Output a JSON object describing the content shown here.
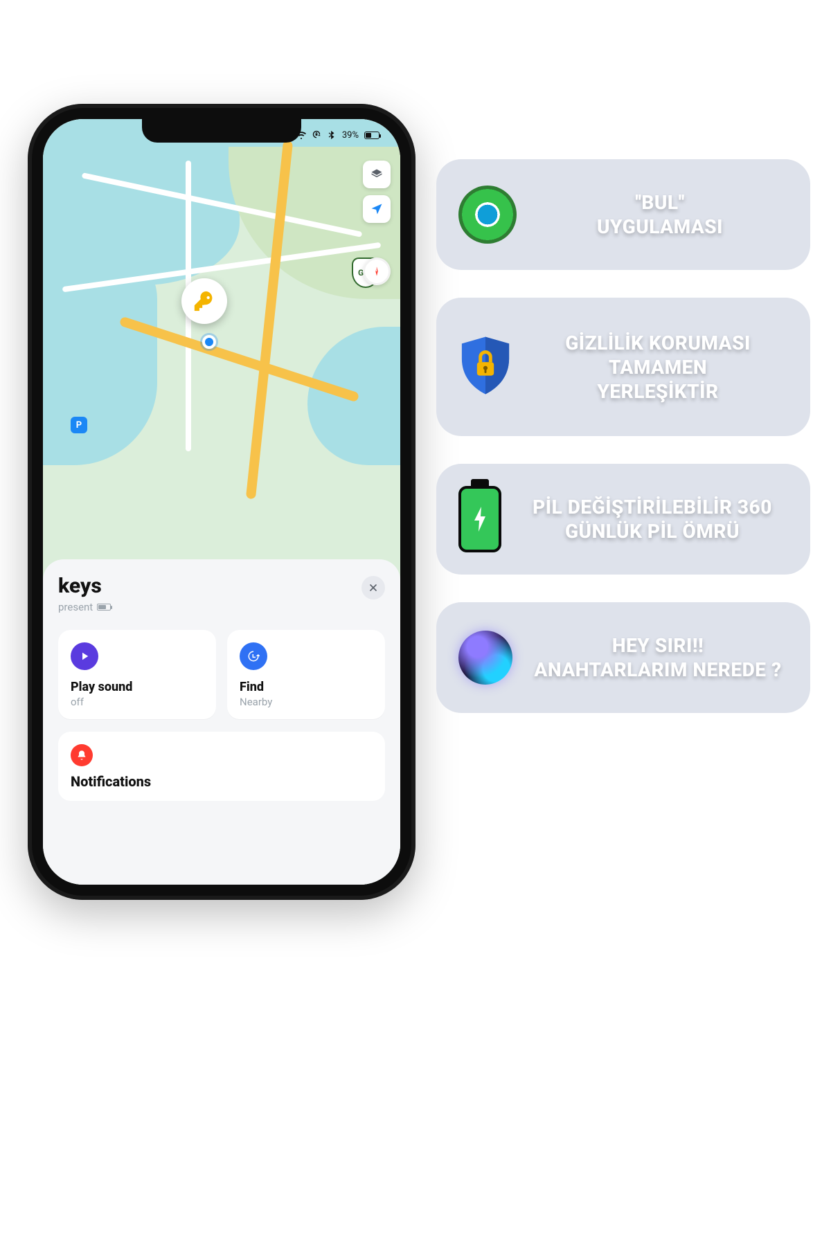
{
  "status": {
    "battery_text": "39%"
  },
  "map": {
    "highway_shield": "G15",
    "park_mark": "P"
  },
  "sheet": {
    "title": "keys",
    "subtitle": "present",
    "play": {
      "title": "Play sound",
      "sub": "off"
    },
    "find": {
      "title": "Find",
      "sub": "Nearby"
    },
    "notifications": "Notifications"
  },
  "features": {
    "find_app": "''BUL''\nUYGULAMASI",
    "privacy": "GİZLİLİK KORUMASI\nTAMAMEN\nYERLEŞİKTİR",
    "battery": "PİL DEĞİŞTİRİLEBİLİR 360\nGÜNLÜK PİL ÖMRÜ",
    "siri": "HEY SIRI!!\nANAHTARLARIM NEREDE ?"
  }
}
